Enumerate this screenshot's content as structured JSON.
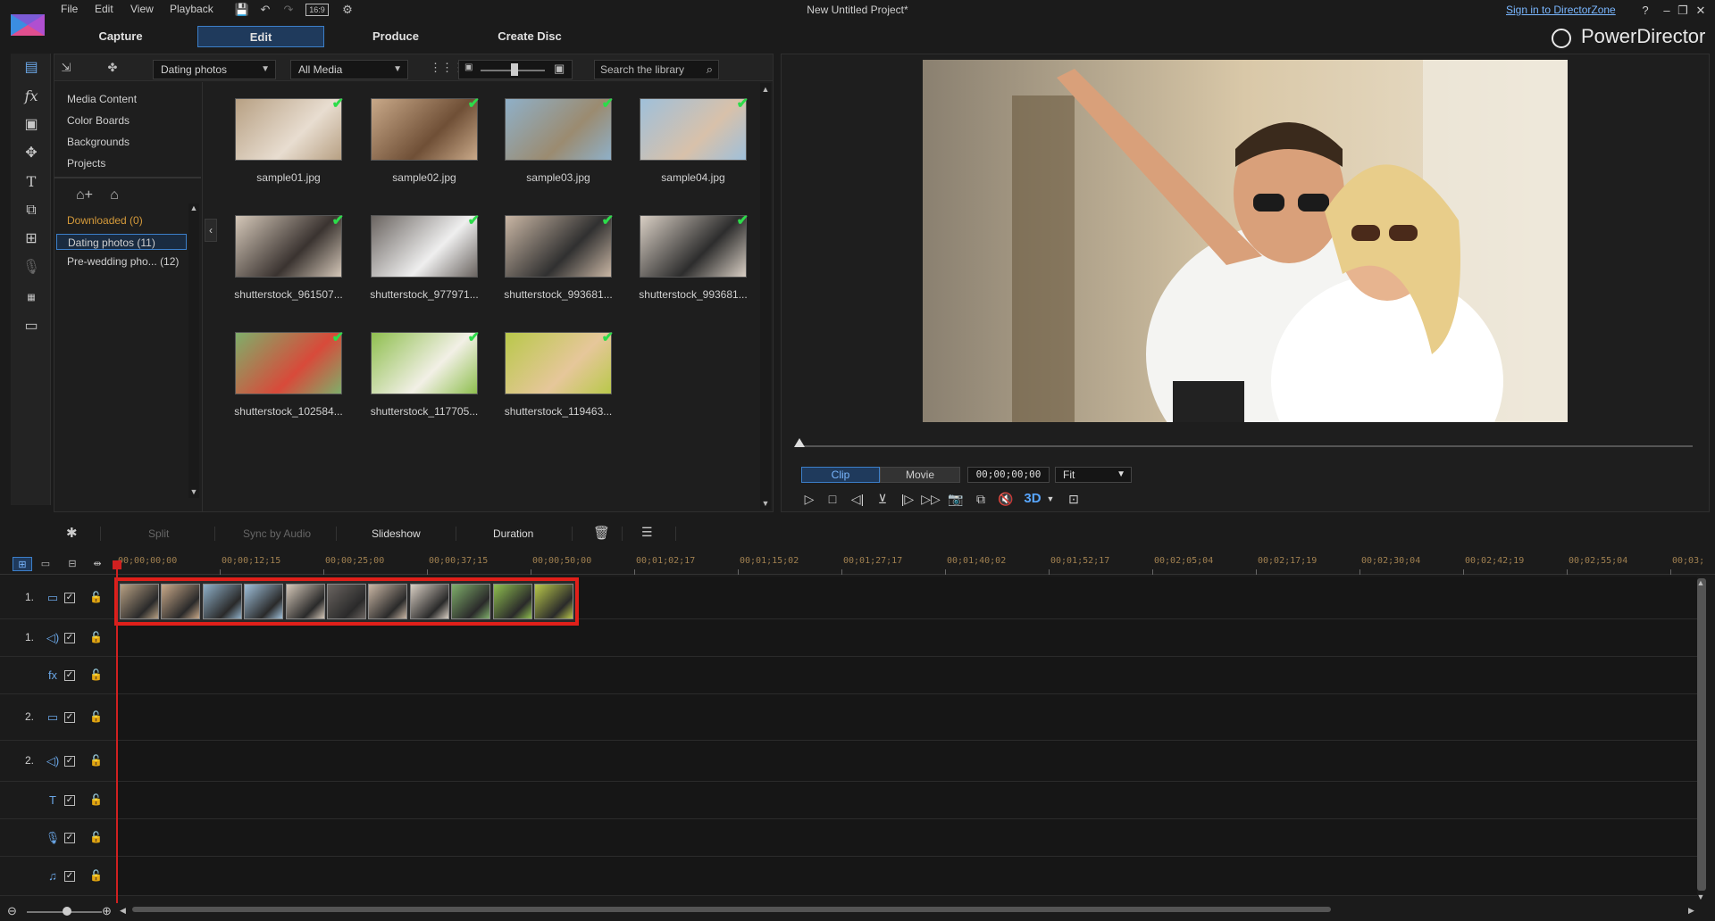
{
  "app": {
    "window_title": "New Untitled Project*",
    "brand": "PowerDirector",
    "signin_link": "Sign in to DirectorZone",
    "menu": [
      "File",
      "Edit",
      "View",
      "Playback"
    ],
    "aspect_ratio": "16:9",
    "help": "?"
  },
  "modes": {
    "capture": "Capture",
    "edit": "Edit",
    "produce": "Produce",
    "create_disc": "Create Disc"
  },
  "library": {
    "album_dropdown": "Dating photos",
    "filter_dropdown": "All Media",
    "search_placeholder": "Search the library",
    "sections": [
      "Media Content",
      "Color Boards",
      "Backgrounds",
      "Projects"
    ],
    "downloaded": "Downloaded  (0)",
    "tags": [
      {
        "label": "Dating photos  (11)"
      },
      {
        "label": "Pre-wedding pho...  (12)"
      }
    ],
    "media": [
      {
        "name": "sample01.jpg",
        "c1": "#b7a083",
        "c2": "#e8ddd0"
      },
      {
        "name": "sample02.jpg",
        "c1": "#c9a989",
        "c2": "#6f4f36"
      },
      {
        "name": "sample03.jpg",
        "c1": "#8fb0c8",
        "c2": "#9b8b70"
      },
      {
        "name": "sample04.jpg",
        "c1": "#9fc0da",
        "c2": "#d8c1aa"
      },
      {
        "name": "shutterstock_961507...",
        "c1": "#d4c7b8",
        "c2": "#3a3330"
      },
      {
        "name": "shutterstock_977971...",
        "c1": "#6a6460",
        "c2": "#efefef"
      },
      {
        "name": "shutterstock_993681...",
        "c1": "#c9b6a4",
        "c2": "#303030"
      },
      {
        "name": "shutterstock_993681...",
        "c1": "#d9cfc4",
        "c2": "#2d2d2d"
      },
      {
        "name": "shutterstock_102584...",
        "c1": "#7fae6a",
        "c2": "#d84a3a"
      },
      {
        "name": "shutterstock_117705...",
        "c1": "#8fbf4f",
        "c2": "#f2f0e6"
      },
      {
        "name": "shutterstock_119463...",
        "c1": "#b9c84a",
        "c2": "#e6c79a"
      }
    ]
  },
  "preview": {
    "clip_label": "Clip",
    "movie_label": "Movie",
    "timecode": "00;00;00;00",
    "fit": "Fit",
    "threed": "3D"
  },
  "timeline": {
    "tools": {
      "split": "Split",
      "sync": "Sync by Audio",
      "slideshow": "Slideshow",
      "duration": "Duration"
    },
    "ruler_labels": [
      "00;00;00;00",
      "00;00;12;15",
      "00;00;25;00",
      "00;00;37;15",
      "00;00;50;00",
      "00;01;02;17",
      "00;01;15;02",
      "00;01;27;17",
      "00;01;40;02",
      "00;01;52;17",
      "00;02;05;04",
      "00;02;17;19",
      "00;02;30;04",
      "00;02;42;19",
      "00;02;55;04",
      "00;03;"
    ],
    "tracks": [
      {
        "num": "1.",
        "icon": "video-icon",
        "glyph": "▭",
        "height": 48
      },
      {
        "num": "1.",
        "icon": "audio-icon",
        "glyph": "◁)",
        "height": 42
      },
      {
        "num": "",
        "icon": "fx-icon",
        "glyph": "fx",
        "height": 42
      },
      {
        "num": "2.",
        "icon": "video-icon",
        "glyph": "▭",
        "height": 52
      },
      {
        "num": "2.",
        "icon": "audio-icon",
        "glyph": "◁)",
        "height": 46
      },
      {
        "num": "",
        "icon": "title-icon",
        "glyph": "T",
        "height": 42
      },
      {
        "num": "",
        "icon": "voice-icon",
        "glyph": "🎙",
        "height": 42
      },
      {
        "num": "",
        "icon": "music-icon",
        "glyph": "♫",
        "height": 44
      }
    ],
    "clip_colors": [
      "#b7a083",
      "#c9a989",
      "#8fb0c8",
      "#9fc0da",
      "#d4c7b8",
      "#6a6460",
      "#c9b6a4",
      "#d9cfc4",
      "#7fae6a",
      "#8fbf4f",
      "#b9c84a"
    ]
  },
  "colors": {
    "accent": "#3c7fc9",
    "highlight_box": "#e0201a",
    "check": "#2cdc4a"
  }
}
